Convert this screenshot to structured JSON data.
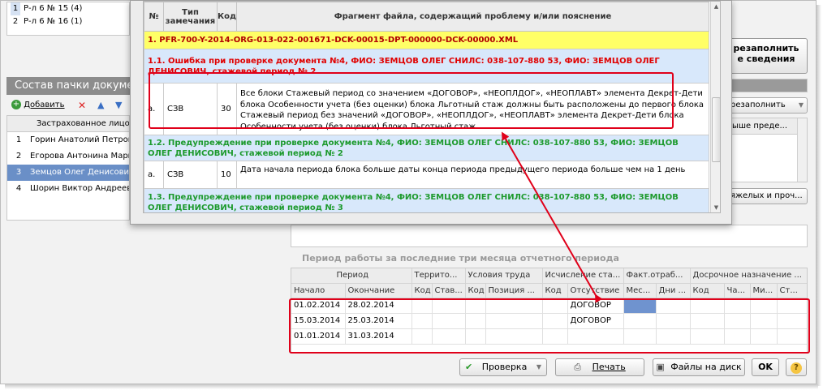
{
  "top_list": [
    {
      "num": "1",
      "label": "Р-л 6 № 15 (4)"
    },
    {
      "num": "2",
      "label": "Р-л 6 № 16 (1)"
    }
  ],
  "section_title": "Состав пачки документов",
  "toolbar": {
    "add_label": "Добавить"
  },
  "insured": {
    "header": "Застрахованное лицо",
    "rows": [
      {
        "num": "1",
        "name": "Горин Анатолий Петрович",
        "selected": false
      },
      {
        "num": "2",
        "name": "Егорова Антонина Марковна",
        "selected": false
      },
      {
        "num": "3",
        "name": "Земцов Олег Денисович",
        "selected": true
      },
      {
        "num": "4",
        "name": "Шорин Виктор Андреевич",
        "selected": false
      }
    ]
  },
  "right_panel": {
    "refill_label_1": "резаполнить",
    "refill_label_2": "е сведения",
    "refill_small": "резаполнить",
    "prev_label": "ыше преде...",
    "heavy_label": "яжелых и проч..."
  },
  "period": {
    "caption": "Период работы за последние три месяца отчетного периода",
    "group_headers": [
      "Период",
      "Террито...",
      "Условия труда",
      "Исчисление ста...",
      "Факт.отраб...",
      "Досрочное назначение ..."
    ],
    "sub_headers": [
      "Начало",
      "Окончание",
      "Код",
      "Став...",
      "Код",
      "Позиция ...",
      "Код",
      "Отсутствие",
      "Мес...",
      "Дни ...",
      "Код",
      "Ча...",
      "Ми...",
      "Ст..."
    ],
    "rows": [
      {
        "start": "01.02.2014",
        "end": "28.02.2014",
        "absence": "ДОГОВОР",
        "highlight": true
      },
      {
        "start": "15.03.2014",
        "end": "25.03.2014",
        "absence": "ДОГОВОР",
        "highlight": false
      },
      {
        "start": "01.01.2014",
        "end": "31.03.2014",
        "absence": "",
        "highlight": false
      }
    ]
  },
  "bottom_bar": {
    "check_label": "Проверка",
    "print_label": "Печать",
    "files_label": "Файлы на диск",
    "ok_label": "OK",
    "help_label": "?"
  },
  "popup": {
    "headers": {
      "num": "№",
      "type": "Тип замечания",
      "code": "Код",
      "fragment": "Фрагмент файла, содержащий проблему и/или пояснение"
    },
    "file_row": "1. PFR-700-Y-2014-ORG-013-022-001671-DCK-00015-DPT-000000-DCK-00000.XML",
    "error_row": "1.1. Ошибка при проверке документа №4, ФИО: ЗЕМЦОВ ОЛЕГ СНИЛС: 038-107-880 53, ФИО: ЗЕМЦОВ ОЛЕГ ДЕНИСОВИЧ, стажевой период № 2",
    "detail_1": {
      "num": "а.",
      "type": "СЗВ",
      "code": "30",
      "text": "Все блоки Стажевый период со значением «ДОГОВОР», «НЕОПЛДОГ», «НЕОПЛАВТ» элемента Декрет-Дети блока Особенности учета (без оценки) блока Льготный стаж должны быть расположены до первого блока Стажевый период без значений «ДОГОВОР», «НЕОПЛДОГ», «НЕОПЛАВТ» элемента Декрет-Дети блока Особенности учета (без оценки) блока Льготный стаж"
    },
    "warn_row_1": "1.2. Предупреждение при проверке документа №4, ФИО: ЗЕМЦОВ ОЛЕГ СНИЛС: 038-107-880 53, ФИО: ЗЕМЦОВ ОЛЕГ ДЕНИСОВИЧ, стажевой период № 2",
    "detail_2": {
      "num": "а.",
      "type": "СЗВ",
      "code": "10",
      "text": "Дата начала периода блока больше даты конца периода предыдущего периода больше чем на 1 день"
    },
    "warn_row_2": "1.3. Предупреждение при проверке документа №4, ФИО: ЗЕМЦОВ ОЛЕГ СНИЛС: 038-107-880 53, ФИО: ЗЕМЦОВ ОЛЕГ ДЕНИСОВИЧ, стажевой период № 3"
  },
  "colors": {
    "annotation_red": "#e0001a",
    "selection_blue": "#6a8fc7",
    "file_row_yellow": "#ffff66"
  }
}
